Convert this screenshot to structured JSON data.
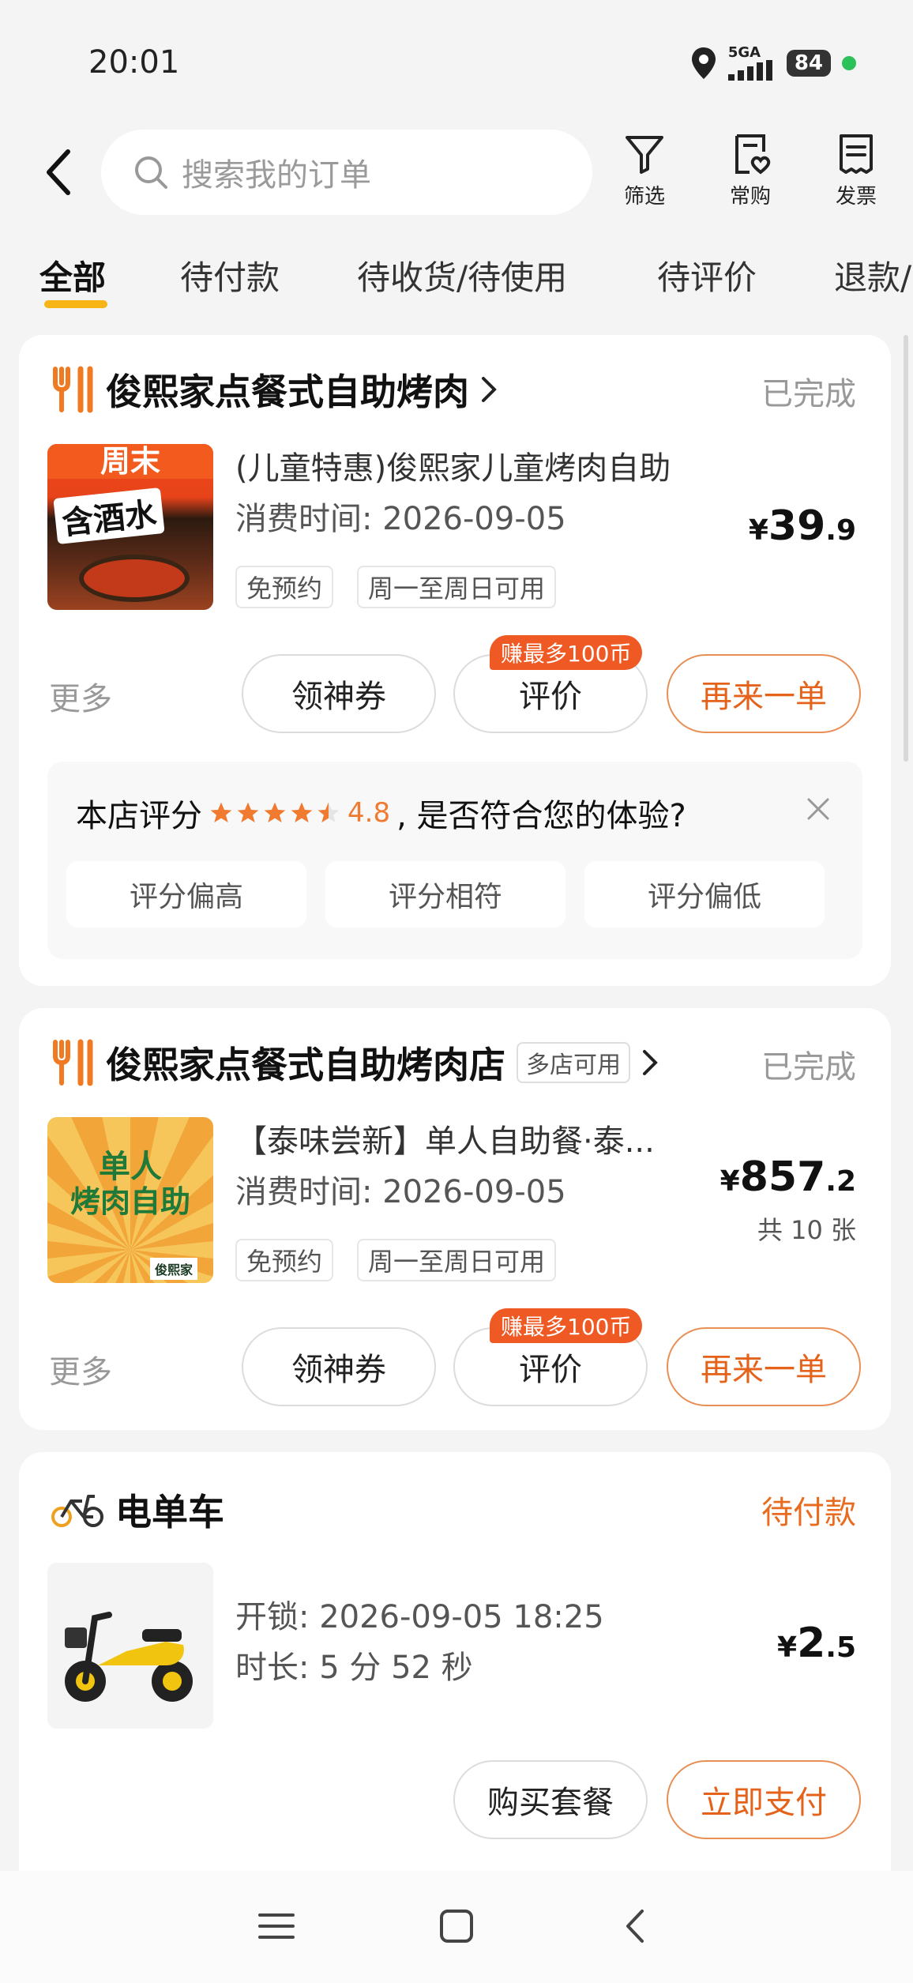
{
  "status_bar": {
    "time": "20:01",
    "network": "5GA",
    "battery": "84"
  },
  "header": {
    "search_placeholder": "搜索我的订单",
    "actions": [
      {
        "label": "筛选",
        "icon": "filter-icon"
      },
      {
        "label": "常购",
        "icon": "frequent-purchase-icon"
      },
      {
        "label": "发票",
        "icon": "invoice-icon"
      }
    ]
  },
  "tabs": [
    "全部",
    "待付款",
    "待收货/待使用",
    "待评价",
    "退款/"
  ],
  "active_tab": "全部",
  "orders": [
    {
      "shop": "俊熙家点餐式自助烤肉",
      "status": "已完成",
      "title": "(儿童特惠)俊熙家儿童烤肉自助",
      "time": "消费时间: 2026-09-05",
      "tags": [
        "免预约",
        "周一至周日可用"
      ],
      "price": {
        "currency": "¥",
        "int": "39",
        "dec": ".9"
      },
      "more": "更多",
      "buttons": [
        "领神券",
        "评价",
        "再来一单"
      ],
      "badge": "赚最多100币",
      "thumb_text": [
        "周末",
        "含酒水"
      ],
      "rating": {
        "prefix": "本店评分",
        "stars": 4.5,
        "score": "4.8",
        "question": ", 是否符合您的体验?",
        "options": [
          "评分偏高",
          "评分相符",
          "评分偏低"
        ]
      }
    },
    {
      "shop": "俊熙家点餐式自助烤肉店",
      "multi_store": "多店可用",
      "status": "已完成",
      "title": "【泰味尝新】单人自助餐·泰...",
      "time": "消费时间: 2026-09-05",
      "tags": [
        "免预约",
        "周一至周日可用"
      ],
      "price": {
        "currency": "¥",
        "int": "857",
        "dec": ".2"
      },
      "qty": "共 10 张",
      "more": "更多",
      "buttons": [
        "领神券",
        "评价",
        "再来一单"
      ],
      "badge": "赚最多100币",
      "thumb_text": [
        "单人",
        "烤肉自助",
        "俊熙家"
      ]
    },
    {
      "shop": "电单车",
      "status": "待付款",
      "unlock": "开锁: 2026-09-05 18:25",
      "duration": "时长: 5 分 52 秒",
      "price": {
        "currency": "¥",
        "int": "2",
        "dec": ".5"
      },
      "buttons": [
        "购买套餐",
        "立即支付"
      ]
    }
  ],
  "colors": {
    "accent": "#e4621a",
    "tab_underline": "#f6b417",
    "badge": "#ef5a24"
  }
}
